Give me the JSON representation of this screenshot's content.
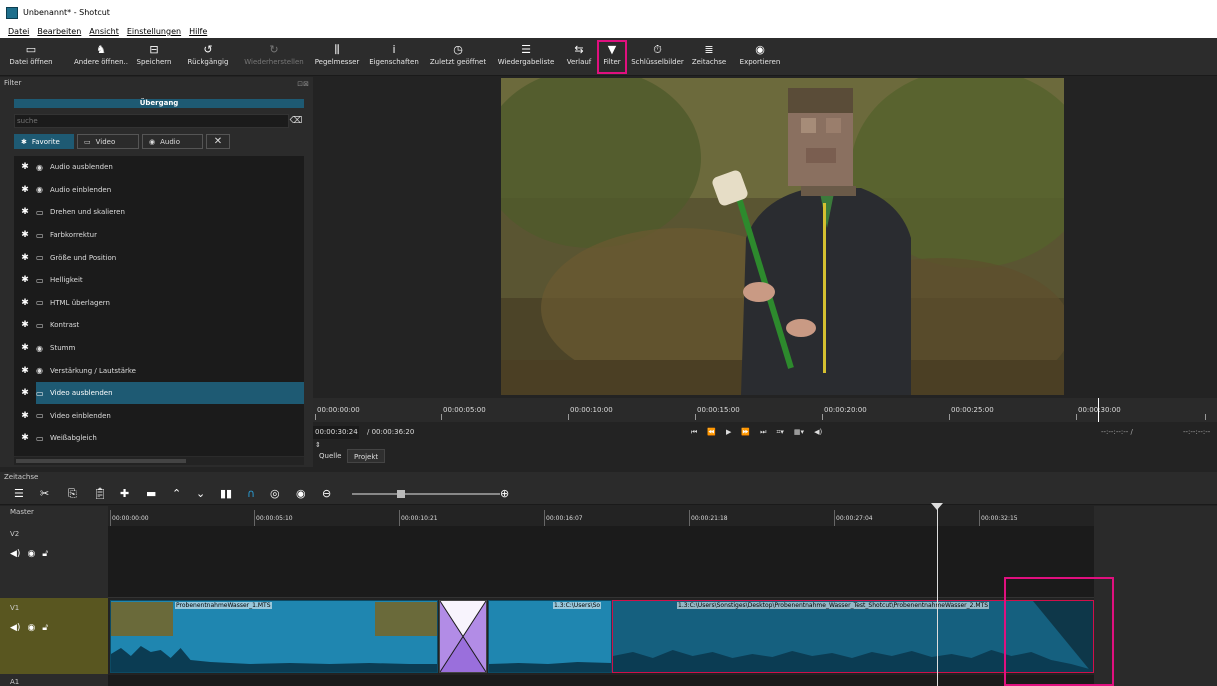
{
  "window": {
    "title": "Unbenannt* - Shotcut"
  },
  "menu": [
    "Datei",
    "Bearbeiten",
    "Ansicht",
    "Einstellungen",
    "Hilfe"
  ],
  "toolbar": [
    {
      "label": "Datei öffnen",
      "icon": "folder-icon"
    },
    {
      "label": "Andere öffnen..",
      "icon": "open-other-icon"
    },
    {
      "label": "Speichern",
      "icon": "save-icon"
    },
    {
      "label": "Rückgängig",
      "icon": "undo-icon"
    },
    {
      "label": "Wiederherstellen",
      "icon": "redo-icon",
      "disabled": true
    },
    {
      "label": "Pegelmesser",
      "icon": "meter-icon"
    },
    {
      "label": "Eigenschaften",
      "icon": "info-icon"
    },
    {
      "label": "Zuletzt geöffnet",
      "icon": "clock-icon"
    },
    {
      "label": "Wiedergabeliste",
      "icon": "list-icon"
    },
    {
      "label": "Verlauf",
      "icon": "history-icon"
    },
    {
      "label": "Filter",
      "icon": "filter-icon",
      "highlighted": true
    },
    {
      "label": "Schlüsselbilder",
      "icon": "stopwatch-icon"
    },
    {
      "label": "Zeitachse",
      "icon": "timeline-icon"
    },
    {
      "label": "Exportieren",
      "icon": "export-icon"
    }
  ],
  "filter_panel": {
    "title": "Filter",
    "transition_label": "Übergang",
    "search_placeholder": "suche",
    "tabs": [
      "Favorite",
      "Video",
      "Audio"
    ],
    "items": [
      {
        "label": "Audio ausblenden",
        "type": "audio"
      },
      {
        "label": "Audio einblenden",
        "type": "audio"
      },
      {
        "label": "Drehen und skalieren",
        "type": "video"
      },
      {
        "label": "Farbkorrektur",
        "type": "video"
      },
      {
        "label": "Größe und Position",
        "type": "video"
      },
      {
        "label": "Helligkeit",
        "type": "video"
      },
      {
        "label": "HTML überlagern",
        "type": "video"
      },
      {
        "label": "Kontrast",
        "type": "video"
      },
      {
        "label": "Stumm",
        "type": "audio"
      },
      {
        "label": "Verstärkung / Lautstärke",
        "type": "audio"
      },
      {
        "label": "Video ausblenden",
        "type": "video",
        "selected": true
      },
      {
        "label": "Video einblenden",
        "type": "video"
      },
      {
        "label": "Weißabgleich",
        "type": "video"
      }
    ]
  },
  "player": {
    "ruler": [
      "00:00:00:00",
      "00:00:05:00",
      "00:00:10:00",
      "00:00:15:00",
      "00:00:20:00",
      "00:00:25:00",
      "00:00:30:00"
    ],
    "current_time": "00:00:30:24",
    "duration": "/ 00:00:36:20",
    "in_point": "--:--:--:-- /",
    "out_point": "--:--:--:--",
    "tabs": [
      "Quelle",
      "Projekt"
    ]
  },
  "timeline": {
    "title": "Zeitachse",
    "ruler": [
      "00:00:00:00",
      "00:00:05:10",
      "00:00:10:21",
      "00:00:16:07",
      "00:00:21:18",
      "00:00:27:04",
      "00:00:32:15"
    ],
    "tracks": [
      "Master",
      "V2",
      "V1",
      "A1"
    ],
    "clips": [
      {
        "label": "ProbenentnahmeWasser_1.MTS"
      },
      {
        "label": "1.3:C:\\Users\\So"
      },
      {
        "label": "1.3:C:\\Users\\Sonstiges\\Desktop\\Probenentnahme_Wasser_Test_Shotcut\\ProbenentnahmeWasser_2.MTS"
      }
    ]
  },
  "colors": {
    "accent": "#1e5a73",
    "highlight": "#e0107f",
    "clip": "#1f86b0",
    "track_v1": "#595620"
  }
}
